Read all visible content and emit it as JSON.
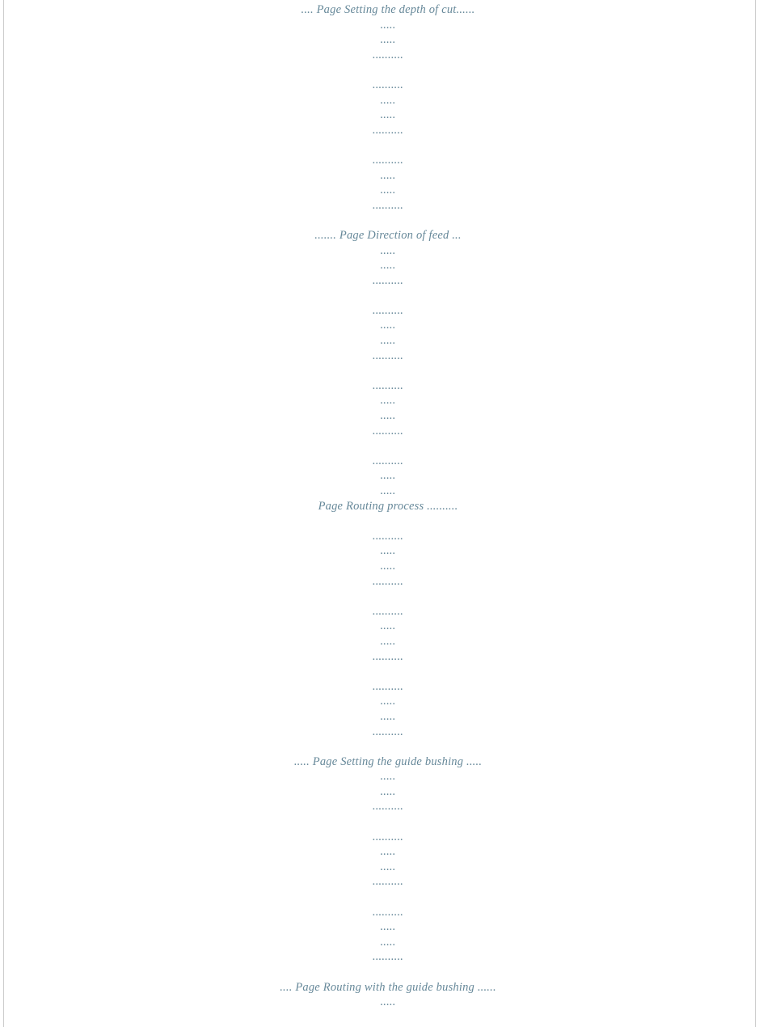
{
  "sections": [
    {
      "heading": ".... Page Setting the depth of cut......",
      "fillerGroups": 3,
      "fillerPattern": [
        ".....",
        ".....",
        ".........."
      ],
      "trailing": []
    },
    {
      "heading": "....... Page Direction of feed ...",
      "fillerGroups": 3,
      "fillerPattern": [
        ".....",
        ".....",
        ".........."
      ],
      "trailing": [
        "..........",
        ".....",
        "....."
      ]
    },
    {
      "heading": "Page Routing process ..........",
      "fillerGroups": 3,
      "fillerPattern": [
        "..........",
        ".....",
        ".....",
        ".........."
      ],
      "trailing": []
    },
    {
      "heading": "..... Page Setting the guide bushing .....",
      "fillerGroups": 3,
      "fillerPattern": [
        ".....",
        ".....",
        ".........."
      ],
      "trailing": []
    },
    {
      "heading": ".... Page Routing with the guide bushing ......",
      "fillerGroups": 0,
      "fillerPattern": [],
      "trailing": [
        "....."
      ]
    }
  ]
}
